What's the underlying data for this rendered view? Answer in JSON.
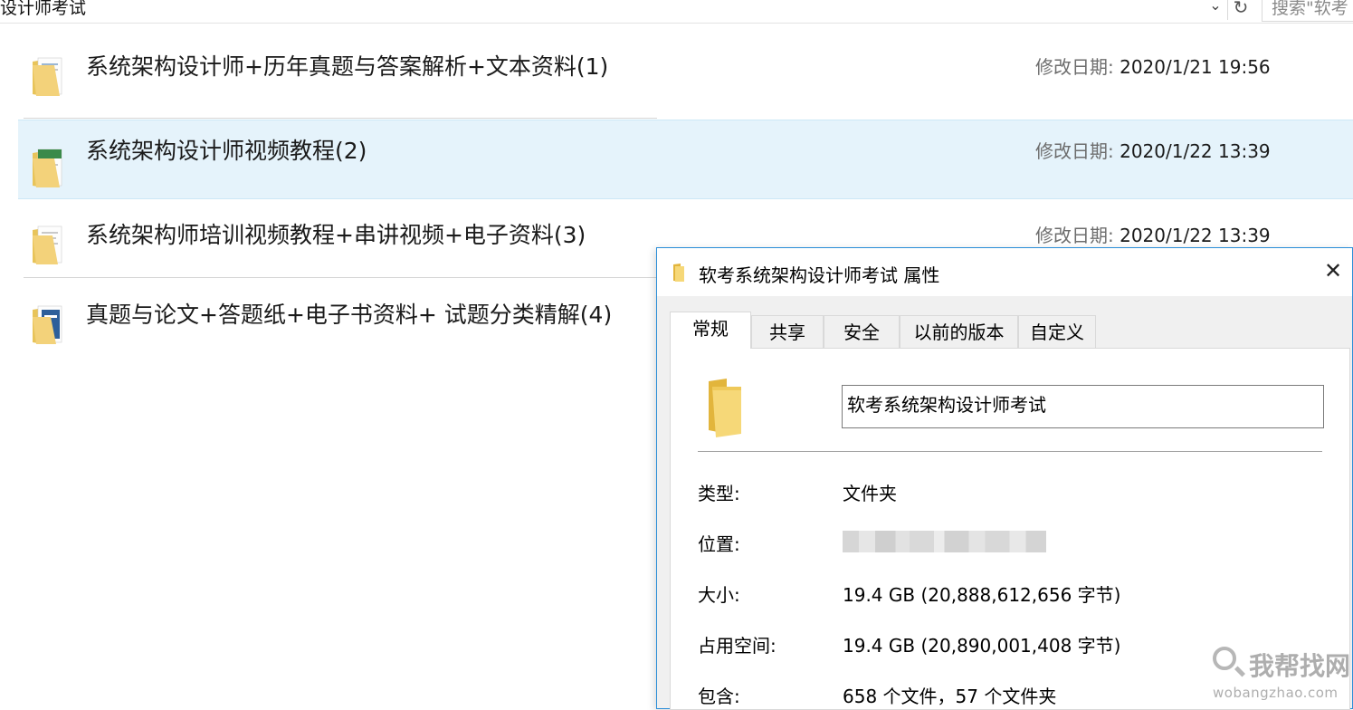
{
  "address_bar": {
    "path_text": "设计师考试",
    "search_placeholder": "搜索\"软考"
  },
  "files": [
    {
      "name": "系统架构设计师+历年真题与答案解析+文本资料(1)",
      "date_label": "修改日期: ",
      "date": "2020/1/21 19:56",
      "selected": false
    },
    {
      "name": "系统架构设计师视频教程(2)",
      "date_label": "修改日期: ",
      "date": "2020/1/22 13:39",
      "selected": true
    },
    {
      "name": "系统架构师培训视频教程+串讲视频+电子资料(3)",
      "date_label": "修改日期: ",
      "date": "2020/1/22 13:39",
      "selected": false
    },
    {
      "name": "真题与论文+答题纸+电子书资料+ 试题分类精解(4)",
      "selected": false
    }
  ],
  "dialog": {
    "title": "软考系统架构设计师考试 属性",
    "tabs": [
      "常规",
      "共享",
      "安全",
      "以前的版本",
      "自定义"
    ],
    "active_tab": "常规",
    "folder_name": "软考系统架构设计师考试",
    "properties": {
      "type_label": "类型:",
      "type_value": "文件夹",
      "location_label": "位置:",
      "size_label": "大小:",
      "size_value": "19.4 GB (20,888,612,656 字节)",
      "disk_label": "占用空间:",
      "disk_value": "19.4 GB (20,890,001,408 字节)",
      "contains_label": "包含:",
      "contains_value": "658 个文件，57 个文件夹"
    }
  },
  "watermark": {
    "cn": "我帮找网",
    "en": "wobangzhao.com"
  }
}
